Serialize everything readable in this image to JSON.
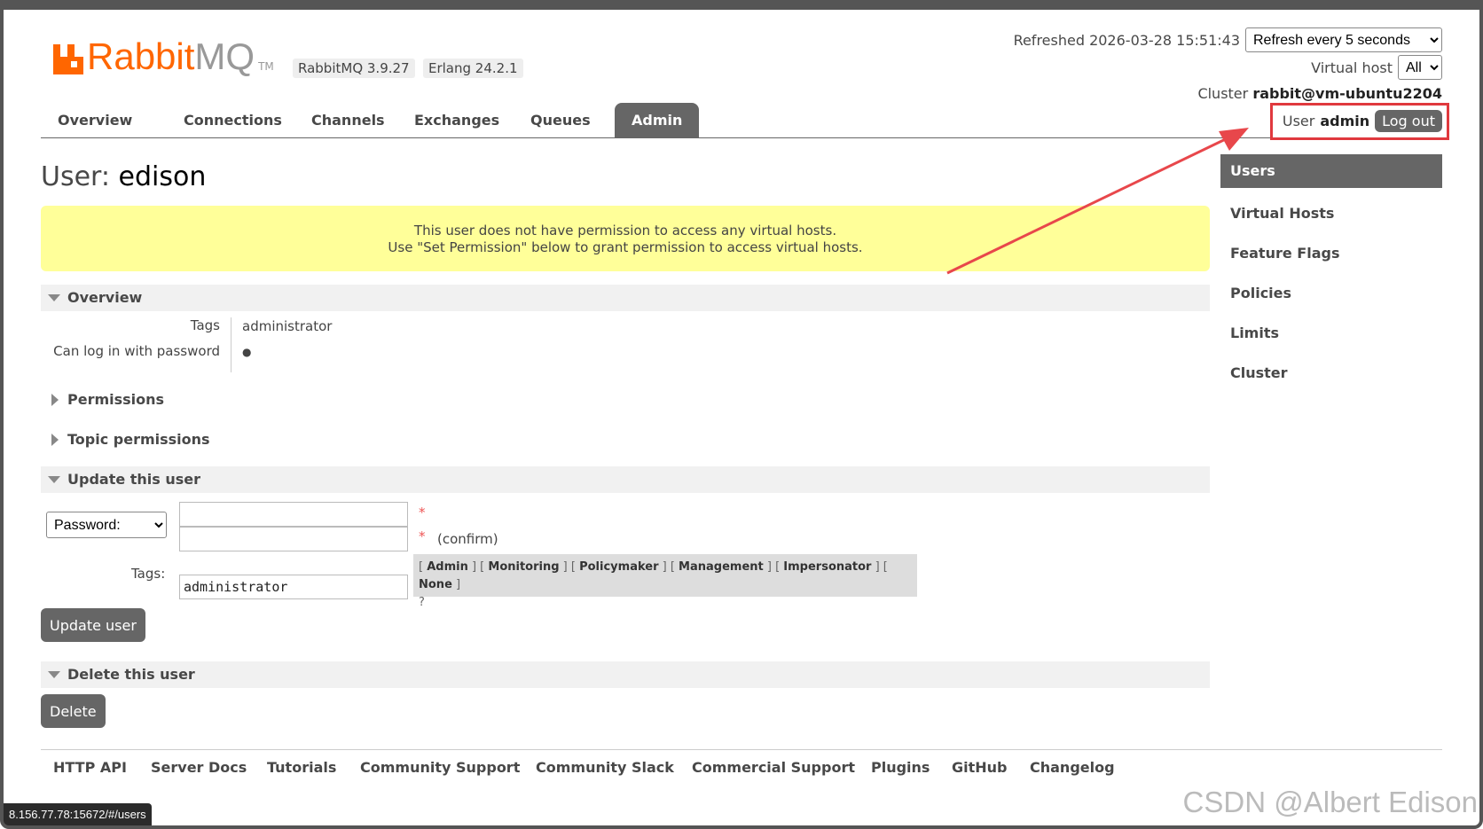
{
  "header": {
    "logo_rabbit": "Rabbit",
    "logo_mq": "MQ",
    "logo_tm": "TM",
    "rabbitmq_version": "RabbitMQ 3.9.27",
    "erlang_version": "Erlang 24.2.1",
    "refreshed_label": "Refreshed 2026-03-28 15:51:43",
    "refresh_option": "Refresh every 5 seconds",
    "virtual_host_label": "Virtual host",
    "virtual_host_value": "All",
    "cluster_label": "Cluster",
    "cluster_name": "rabbit@vm-ubuntu2204",
    "user_label": "User",
    "user_name": "admin",
    "logout_label": "Log out"
  },
  "nav": {
    "tabs": [
      {
        "label": "Overview"
      },
      {
        "label": "Connections"
      },
      {
        "label": "Channels"
      },
      {
        "label": "Exchanges"
      },
      {
        "label": "Queues"
      },
      {
        "label": "Admin"
      }
    ],
    "active": "Admin"
  },
  "page": {
    "title_prefix": "User:",
    "title_name": "edison",
    "warning_line1": "This user does not have permission to access any virtual hosts.",
    "warning_line2": "Use \"Set Permission\" below to grant permission to access virtual hosts."
  },
  "overview": {
    "heading": "Overview",
    "tags_key": "Tags",
    "tags_value": "administrator",
    "login_key": "Can log in with password",
    "login_value": "●"
  },
  "permissions": {
    "heading": "Permissions"
  },
  "topic_permissions": {
    "heading": "Topic permissions"
  },
  "update": {
    "heading": "Update this user",
    "password_select": "Password:",
    "star": "*",
    "confirm_label": "(confirm)",
    "tags_label": "Tags:",
    "tags_value": "administrator",
    "tag_options": [
      "Admin",
      "Monitoring",
      "Policymaker",
      "Management",
      "Impersonator",
      "None"
    ],
    "help": "?",
    "button": "Update user"
  },
  "delete": {
    "heading": "Delete this user",
    "button": "Delete"
  },
  "sidebar": {
    "items": [
      {
        "label": "Users"
      },
      {
        "label": "Virtual Hosts"
      },
      {
        "label": "Feature Flags"
      },
      {
        "label": "Policies"
      },
      {
        "label": "Limits"
      },
      {
        "label": "Cluster"
      }
    ]
  },
  "footer": {
    "links": [
      "HTTP API",
      "Server Docs",
      "Tutorials",
      "Community Support",
      "Community Slack",
      "Commercial Support",
      "Plugins",
      "GitHub",
      "Changelog"
    ]
  },
  "status_url": "8.156.77.78:15672/#/users",
  "watermark": "CSDN @Albert Edison",
  "colors": {
    "brand": "#ff6600",
    "accent_gray": "#666666",
    "warning_bg": "#ffff99",
    "annotation_red": "#e0393e"
  }
}
